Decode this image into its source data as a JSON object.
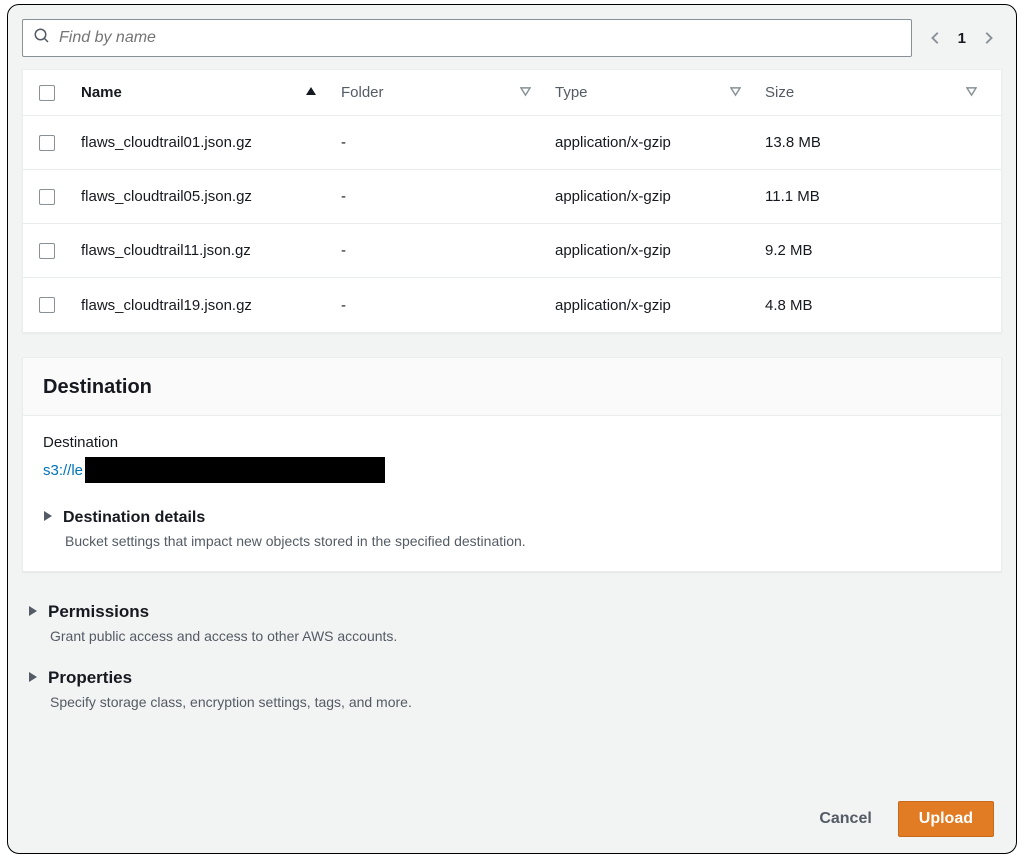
{
  "search": {
    "placeholder": "Find by name"
  },
  "pagination": {
    "current": "1"
  },
  "table": {
    "headers": {
      "name": "Name",
      "folder": "Folder",
      "type": "Type",
      "size": "Size"
    },
    "rows": [
      {
        "name": "flaws_cloudtrail01.json.gz",
        "folder": "-",
        "type": "application/x-gzip",
        "size": "13.8 MB"
      },
      {
        "name": "flaws_cloudtrail05.json.gz",
        "folder": "-",
        "type": "application/x-gzip",
        "size": "11.1 MB"
      },
      {
        "name": "flaws_cloudtrail11.json.gz",
        "folder": "-",
        "type": "application/x-gzip",
        "size": "9.2 MB"
      },
      {
        "name": "flaws_cloudtrail19.json.gz",
        "folder": "-",
        "type": "application/x-gzip",
        "size": "4.8 MB"
      }
    ]
  },
  "destination": {
    "title": "Destination",
    "label": "Destination",
    "url_prefix": "s3://le",
    "details_title": "Destination details",
    "details_desc": "Bucket settings that impact new objects stored in the specified destination."
  },
  "permissions": {
    "title": "Permissions",
    "desc": "Grant public access and access to other AWS accounts."
  },
  "properties": {
    "title": "Properties",
    "desc": "Specify storage class, encryption settings, tags, and more."
  },
  "footer": {
    "cancel": "Cancel",
    "upload": "Upload"
  }
}
